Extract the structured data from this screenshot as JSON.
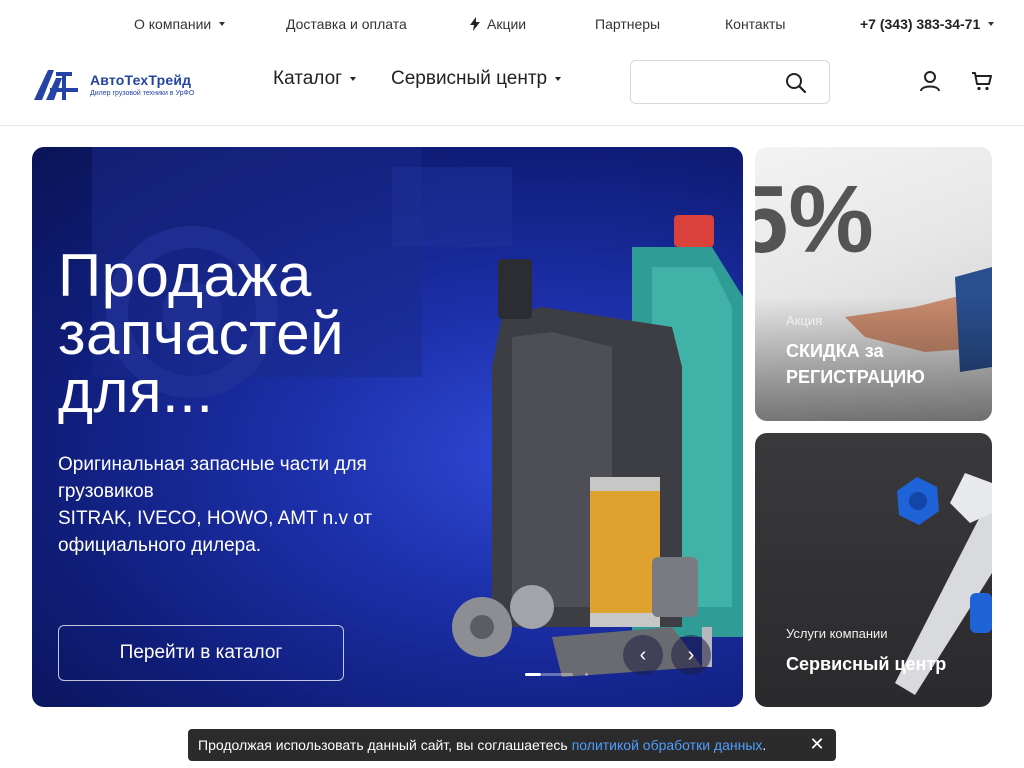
{
  "topbar": {
    "about": "О компании",
    "delivery": "Доставка и оплата",
    "promos": "Акции",
    "partners": "Партнеры",
    "contacts": "Контакты",
    "phone": "+7 (343) 383-34-71"
  },
  "logo": {
    "name": "АвтоТехТрейд",
    "tagline": "Дилер грузовой техники в УрФО"
  },
  "nav": {
    "catalog": "Каталог",
    "service": "Сервисный центр"
  },
  "search": {
    "placeholder": ""
  },
  "hero": {
    "title_lines": [
      "Продажа",
      "запчастей",
      "для..."
    ],
    "desc_lines": [
      "Оригинальная запасные части для",
      "грузовиков",
      "SITRAK, IVECO, HOWO, AMT n.v от",
      "официального дилера."
    ],
    "button": "Перейти в каталог",
    "prev": "‹",
    "next": "›",
    "slides_total": 3,
    "slide_active": 1
  },
  "cards": [
    {
      "tag": "Акция",
      "title_lines": [
        "СКИДКА за",
        "РЕГИСТРАЦИЮ"
      ]
    },
    {
      "tag": "Услуги компании",
      "title_lines": [
        "Сервисный центр"
      ]
    }
  ],
  "cookie": {
    "text": "Продолжая использовать данный сайт, вы соглашаетесь",
    "link": "политикой обработки данных",
    "end": ".",
    "close": "✕"
  },
  "colors": {
    "brand": "#2443a4",
    "hero_bg": "#1c2fa8",
    "link": "#4f9dff",
    "cookie_bg": "#2b2b2b"
  },
  "icons": [
    "bolt-icon",
    "search-icon",
    "user-icon",
    "cart-icon",
    "chevron-left-icon",
    "chevron-right-icon",
    "close-icon"
  ]
}
